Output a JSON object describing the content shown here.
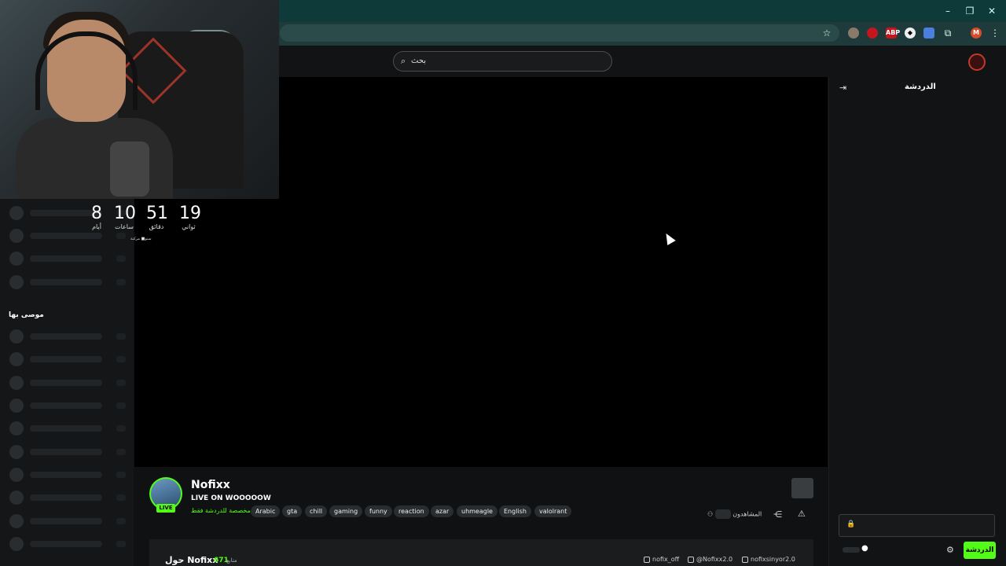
{
  "browser": {
    "minimize": "–",
    "restore": "❐",
    "close": "✕",
    "profile_initial": "M",
    "ext_abp": "ABP"
  },
  "header": {
    "search_placeholder": "بحث"
  },
  "countdown": {
    "days": "8",
    "days_label": "أيام",
    "hours": "10",
    "hours_label": "ساعات",
    "minutes": "51",
    "minutes_label": "دقائق",
    "seconds": "19",
    "seconds_label": "ثواني",
    "note": "سنو■ مركبة"
  },
  "sidebar": {
    "recommended_title": "موصى بها"
  },
  "channel": {
    "name": "Nofixx",
    "title": "LIVE ON WOOOOOW",
    "live_badge": "LIVE",
    "category": "مخصصة للدردشة فقط",
    "tags": [
      "Arabic",
      "gta",
      "chill",
      "gaming",
      "funny",
      "reaction",
      "azar",
      "uhmeagle",
      "English",
      "valolrant"
    ],
    "viewers_label": "المشاهدون"
  },
  "about": {
    "title": "حول Nofixx",
    "followers_count": "671",
    "followers_label": "متابع",
    "instagram": "nofix_off",
    "youtube": "@Nofixx2.0",
    "discord": "nofixsinyor2.0"
  },
  "chat": {
    "title": "الدردشة",
    "send_label": "الدردشة"
  },
  "colors": {
    "accent": "#53fc18",
    "chrome": "#0e3a3a",
    "background": "#0f1112"
  }
}
